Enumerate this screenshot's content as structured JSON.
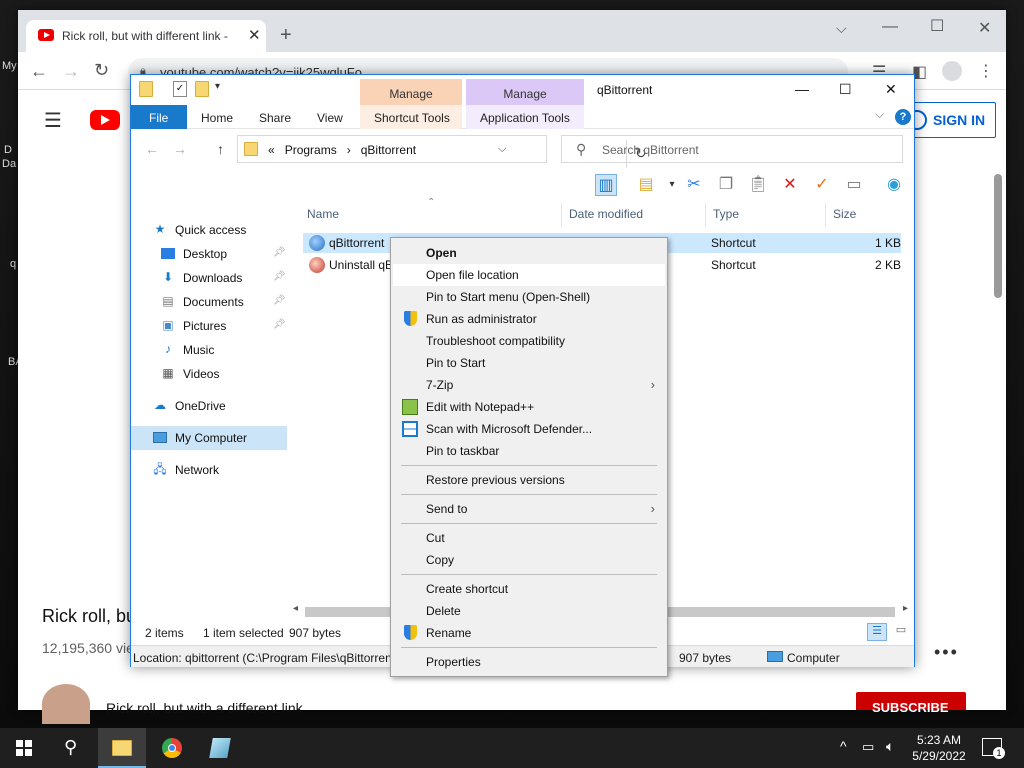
{
  "desktop": {
    "labels": [
      "My",
      "D",
      "Da",
      "q",
      "BA"
    ]
  },
  "chrome": {
    "tab_title": "Rick roll, but with different link -",
    "url": "youtube.com/watch?v=iik25wqluFo",
    "new_tab": "+"
  },
  "youtube": {
    "sign_in": "SIGN IN",
    "video_title": "Rick roll, bu",
    "views": "12,195,360 vie",
    "channel_line": "Rick roll, but with a different link",
    "subscribe": "SUBSCRIBE",
    "more": "•••"
  },
  "explorer": {
    "title": "qBittorrent",
    "manage1": "Manage",
    "manage2": "Manage",
    "tabs": {
      "file": "File",
      "home": "Home",
      "share": "Share",
      "view": "View",
      "shortcut_tools": "Shortcut Tools",
      "application_tools": "Application Tools"
    },
    "breadcrumb": {
      "overflow": "«",
      "programs": "Programs",
      "sep": "›",
      "current": "qBittorrent"
    },
    "search_placeholder": "Search qBittorrent",
    "nav": {
      "quick_access": "Quick access",
      "desktop": "Desktop",
      "downloads": "Downloads",
      "documents": "Documents",
      "pictures": "Pictures",
      "music": "Music",
      "videos": "Videos",
      "onedrive": "OneDrive",
      "my_computer": "My Computer",
      "network": "Network"
    },
    "columns": {
      "name": "Name",
      "date_modified": "Date modified",
      "type": "Type",
      "size": "Size"
    },
    "files": [
      {
        "name": "qBittorrent",
        "type": "Shortcut",
        "size": "1 KB"
      },
      {
        "name": "Uninstall qB",
        "type": "Shortcut",
        "size": "2 KB"
      }
    ],
    "status": {
      "items": "2 items",
      "selected": "1 item selected",
      "bytes": "907 bytes"
    },
    "details": {
      "location": "Location: qbittorrent (C:\\Program Files\\qBittorren",
      "bytes": "907 bytes",
      "computer": "Computer"
    }
  },
  "context_menu": {
    "open": "Open",
    "open_file_location": "Open file location",
    "pin_start_openshell": "Pin to Start menu (Open-Shell)",
    "run_as_admin": "Run as administrator",
    "troubleshoot": "Troubleshoot compatibility",
    "pin_to_start": "Pin to Start",
    "seven_zip": "7-Zip",
    "edit_notepad": "Edit with Notepad++",
    "scan_defender": "Scan with Microsoft Defender...",
    "pin_taskbar": "Pin to taskbar",
    "restore_versions": "Restore previous versions",
    "send_to": "Send to",
    "cut": "Cut",
    "copy": "Copy",
    "create_shortcut": "Create shortcut",
    "delete": "Delete",
    "rename": "Rename",
    "properties": "Properties"
  },
  "taskbar": {
    "time": "5:23 AM",
    "date": "5/29/2022",
    "notification_count": "1"
  },
  "colors": {
    "accent": "#1979ca",
    "selection": "#cce8ff",
    "youtube_red": "#ff0000",
    "manage_orange": "#fad3b7",
    "manage_purple": "#dcc8f6"
  }
}
